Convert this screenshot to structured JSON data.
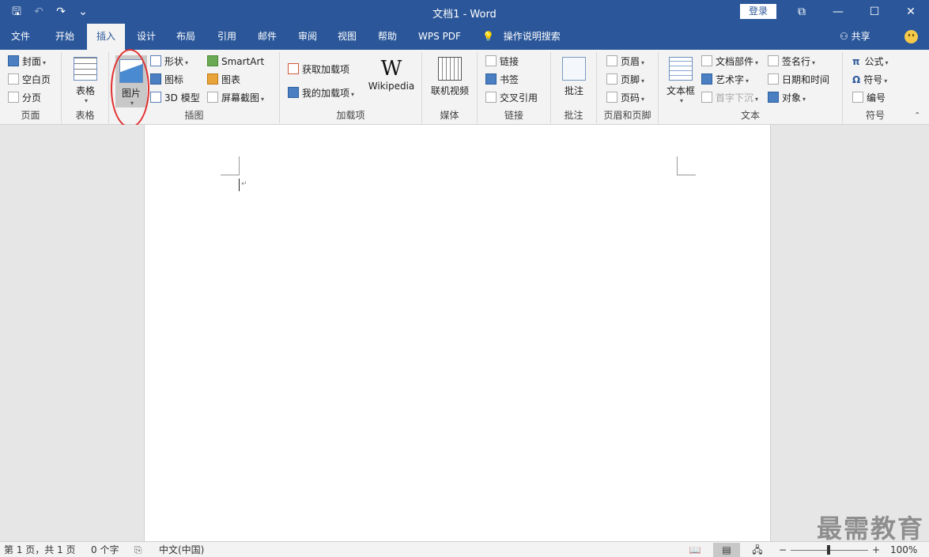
{
  "titlebar": {
    "title": "文档1  -  Word",
    "login": "登录",
    "qat_icons": [
      "save-icon",
      "undo-icon",
      "redo-icon",
      "customize-icon"
    ],
    "qat_glyphs": {
      "save": "🖫",
      "undo": "↶",
      "redo": "↷",
      "more": "⌄"
    },
    "window_glyphs": {
      "ribbon_options": "⧉",
      "minimize": "—",
      "maximize": "☐",
      "close": "✕"
    }
  },
  "tabs": [
    {
      "label": "文件"
    },
    {
      "label": "开始"
    },
    {
      "label": "插入"
    },
    {
      "label": "设计"
    },
    {
      "label": "布局"
    },
    {
      "label": "引用"
    },
    {
      "label": "邮件"
    },
    {
      "label": "审阅"
    },
    {
      "label": "视图"
    },
    {
      "label": "帮助"
    },
    {
      "label": "WPS PDF"
    }
  ],
  "tellme": {
    "glyph": "💡",
    "label": "操作说明搜索"
  },
  "share": {
    "glyph": "⚇",
    "label": "共享"
  },
  "ribbon": {
    "page_group": {
      "label": "页面",
      "items": [
        "封面",
        "空白页",
        "分页"
      ]
    },
    "table_group": {
      "label": "表格",
      "button": "表格"
    },
    "illustration_group": {
      "label": "插图",
      "picture": "图片",
      "items": [
        "形状",
        "图标",
        "3D 模型",
        "SmartArt",
        "图表",
        "屏幕截图"
      ]
    },
    "addin_group": {
      "label": "加载项",
      "items": [
        "获取加载项",
        "我的加载项"
      ],
      "wikipedia_glyph": "W",
      "wikipedia": "Wikipedia"
    },
    "media_group": {
      "label": "媒体",
      "button": "联机视频"
    },
    "link_group": {
      "label": "链接",
      "items": [
        "链接",
        "书签",
        "交叉引用"
      ]
    },
    "comment_group": {
      "label": "批注",
      "button": "批注"
    },
    "header_group": {
      "label": "页眉和页脚",
      "items": [
        "页眉",
        "页脚",
        "页码"
      ]
    },
    "text_group": {
      "label": "文本",
      "textbox": "文本框",
      "items": [
        "文档部件",
        "艺术字",
        "首字下沉",
        "签名行",
        "日期和时间",
        "对象"
      ]
    },
    "symbol_group": {
      "label": "符号",
      "items": [
        "公式",
        "符号",
        "编号"
      ],
      "glyphs": {
        "equation": "π",
        "symbol": "Ω"
      }
    },
    "collapse_glyph": "⌃"
  },
  "document": {
    "watermark": "最需教育"
  },
  "statusbar": {
    "page_info": "第 1 页，共 1 页",
    "word_count": "0 个字",
    "language": "中文(中国)",
    "zoom": "100%",
    "zoom_minus": "−",
    "zoom_plus": "+",
    "glyphs": {
      "proofing": "⎘",
      "read_mode": "📖",
      "print_layout": "▤",
      "web_layout": "🖧"
    }
  }
}
